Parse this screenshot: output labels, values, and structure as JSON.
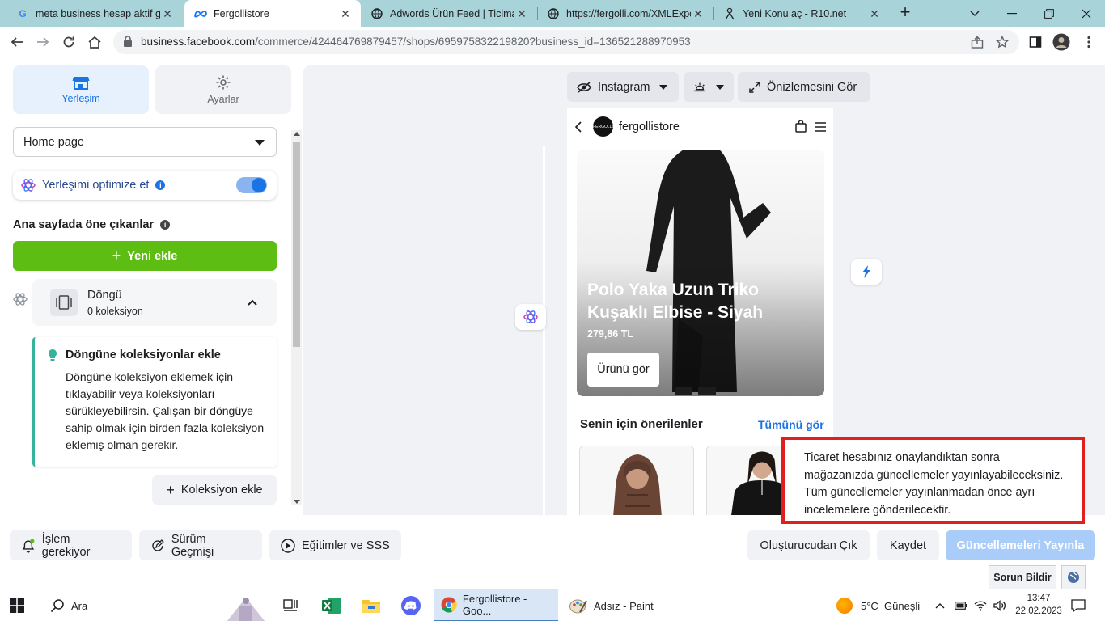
{
  "browser": {
    "tabs": [
      {
        "title": "meta business hesap aktif gö",
        "favicon": "google-g-icon"
      },
      {
        "title": "Fergollistore",
        "favicon": "meta-icon",
        "active": true
      },
      {
        "title": "Adwords Ürün Feed | Ticimax",
        "favicon": "globe-icon"
      },
      {
        "title": "https://fergolli.com/XMLExpo",
        "favicon": "globe-icon"
      },
      {
        "title": "Yeni Konu aç - R10.net",
        "favicon": "r10-icon"
      }
    ],
    "url_host": "business.facebook.com",
    "url_path": "/commerce/424464769879457/shops/695975832219820?business_id=136521288970953"
  },
  "sidebar": {
    "tab_layout": "Yerleşim",
    "tab_settings": "Ayarlar",
    "page_select": "Home page",
    "optimize_label": "Yerleşimi optimize et",
    "section_title": "Ana sayfada öne çıkanlar",
    "add_new": "Yeni ekle",
    "loop": {
      "title": "Döngü",
      "subtitle": "0 koleksiyon"
    },
    "tip": {
      "title": "Döngüne koleksiyonlar ekle",
      "body": "Döngüne koleksiyon eklemek için tıklayabilir veya koleksiyonları sürükleyebilirsin. Çalışan bir döngüye sahip olmak için birden fazla koleksiyon eklemiş olman gerekir."
    },
    "add_collection": "Koleksiyon ekle"
  },
  "preview": {
    "platform": "Instagram",
    "preview_button": "Önizlemesini Gör",
    "shop_name": "fergollistore",
    "avatar_text": "FERGOLLI",
    "hero": {
      "title": "Polo Yaka Uzun Triko Kuşaklı Elbise - Siyah",
      "price": "279,86 TL",
      "cta": "Ürünü gör"
    },
    "recommendations": {
      "title": "Senin için önerilenler",
      "see_all": "Tümünü gör"
    }
  },
  "notice": "Ticaret hesabınız onaylandıktan sonra mağazanızda güncellemeler yayınlayabileceksiniz. Tüm güncellemeler yayınlanmadan önce ayrı incelemelere gönderilecektir.",
  "footer": {
    "action_required": "İşlem gerekiyor",
    "version_history": "Sürüm Geçmişi",
    "tutorials": "Eğitimler ve SSS",
    "exit": "Oluşturucudan Çık",
    "save": "Kaydet",
    "publish": "Güncellemeleri Yayınla",
    "report": "Sorun Bildir"
  },
  "taskbar": {
    "search": "Ara",
    "chrome_item": "Fergollistore - Goo...",
    "paint_item": "Adsız - Paint",
    "weather": "5°C  Güneşli",
    "time": "13:47",
    "date": "22.02.2023"
  },
  "colors": {
    "accent": "#1b74e4",
    "green": "#5ebd12",
    "notice_border": "#e0201e",
    "tabbar": "#a8d4d9"
  }
}
